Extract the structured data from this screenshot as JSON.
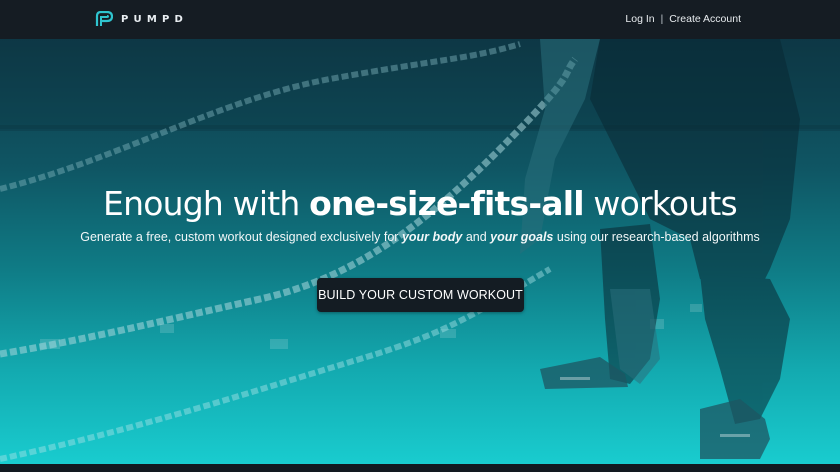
{
  "brand": {
    "name": "PUMPD",
    "icon": "pumpd-logo-icon",
    "accent": "#2fc4cf"
  },
  "nav": {
    "login": "Log In",
    "separator": "|",
    "create_account": "Create Account"
  },
  "hero": {
    "headline_pre": "Enough with ",
    "headline_strong": "one-size-fits-all",
    "headline_post": " workouts",
    "sub_pre": "Generate a free, custom workout designed exclusively for ",
    "sub_emph1": "your body",
    "sub_mid": " and ",
    "sub_emph2": "your goals",
    "sub_post": " using our research-based algorithms",
    "cta": "BUILD YOUR CUSTOM WORKOUT",
    "background_image": "battle-ropes-athlete-photo"
  },
  "colors": {
    "navbar": "#151c23",
    "hero_top": "#0f3c4a",
    "hero_bottom": "#19cccf",
    "button": "#141c23"
  }
}
